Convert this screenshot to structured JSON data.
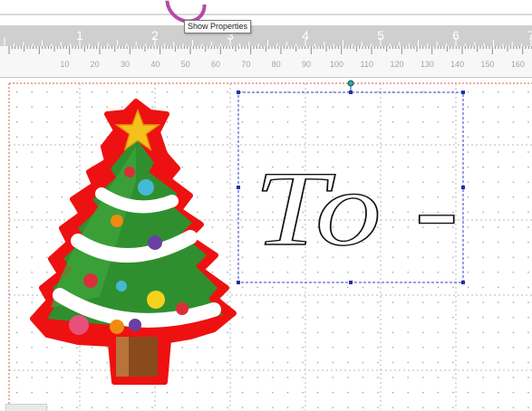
{
  "tooltip": {
    "text": "Show Properties"
  },
  "ruler": {
    "inch_labels": [
      "1",
      "2",
      "3",
      "4",
      "5",
      "6",
      "7"
    ],
    "mm_labels": [
      "10",
      "20",
      "30",
      "40",
      "50",
      "60",
      "70",
      "80",
      "90",
      "100",
      "110",
      "120",
      "130",
      "140",
      "150",
      "160",
      "170"
    ]
  },
  "design": {
    "text_object": "To -",
    "graphic": "christmas-tree",
    "colors": {
      "selection": "#3340c8",
      "page_border": "#e2554d",
      "tree_outline": "#ee1111",
      "tree_green": "#2f8f2e",
      "star": "#f5c21b"
    }
  }
}
